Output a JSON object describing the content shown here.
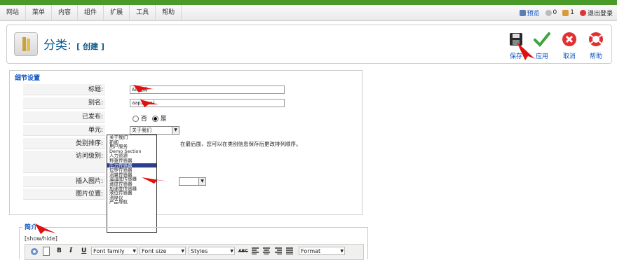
{
  "menu": [
    "网站",
    "菜单",
    "内容",
    "组件",
    "扩展",
    "工具",
    "帮助"
  ],
  "top_right": {
    "preview": "预览",
    "messages": "0",
    "users": "1",
    "logout": "退出登录"
  },
  "toolbar": {
    "title": "分类:",
    "action": "[ 创建 ]",
    "save": "保存",
    "apply": "应用",
    "cancel": "取消",
    "help": "帮助"
  },
  "section1": {
    "legend": "细节设置",
    "title_label": "标题:",
    "title_value": "AA品牌",
    "alias_label": "别名:",
    "alias_value": "aapinpai",
    "published_label": "已发布:",
    "published_no": "否",
    "published_yes": "是",
    "section_label": "单元:",
    "section_value": "关于我们",
    "order_label": "类别排序:",
    "order_note": "在最后面，您可以在类别信息保存后更改排列顺序。",
    "access_label": "访问级别:",
    "image_label": "插入图片:",
    "image_pos_label": "图片位置:"
  },
  "dropdown_options": [
    "关于我们",
    "新闻",
    "用户服务",
    "Demo Section",
    "人力资源",
    "称重传感器",
    "压力传感器",
    "位移传感器",
    "流量传感器",
    "温湿度传感器",
    "速度传感器",
    "加速度传感器",
    "液位传感器",
    "测厚仪",
    "产品导航"
  ],
  "dropdown_selected_index": 6,
  "section2": {
    "legend": "简介",
    "toggle": "[show/hide]"
  },
  "editor": {
    "bold": "B",
    "italic": "I",
    "underline": "U",
    "font_family": "Font family",
    "font_size": "Font size",
    "styles": "Styles",
    "strike": "ABC",
    "format": "Format"
  },
  "colors": {
    "accent": "#0b55c4",
    "topbar": "#4a9a2a",
    "selection": "#2c3f8c",
    "annotation": "#e01010"
  }
}
